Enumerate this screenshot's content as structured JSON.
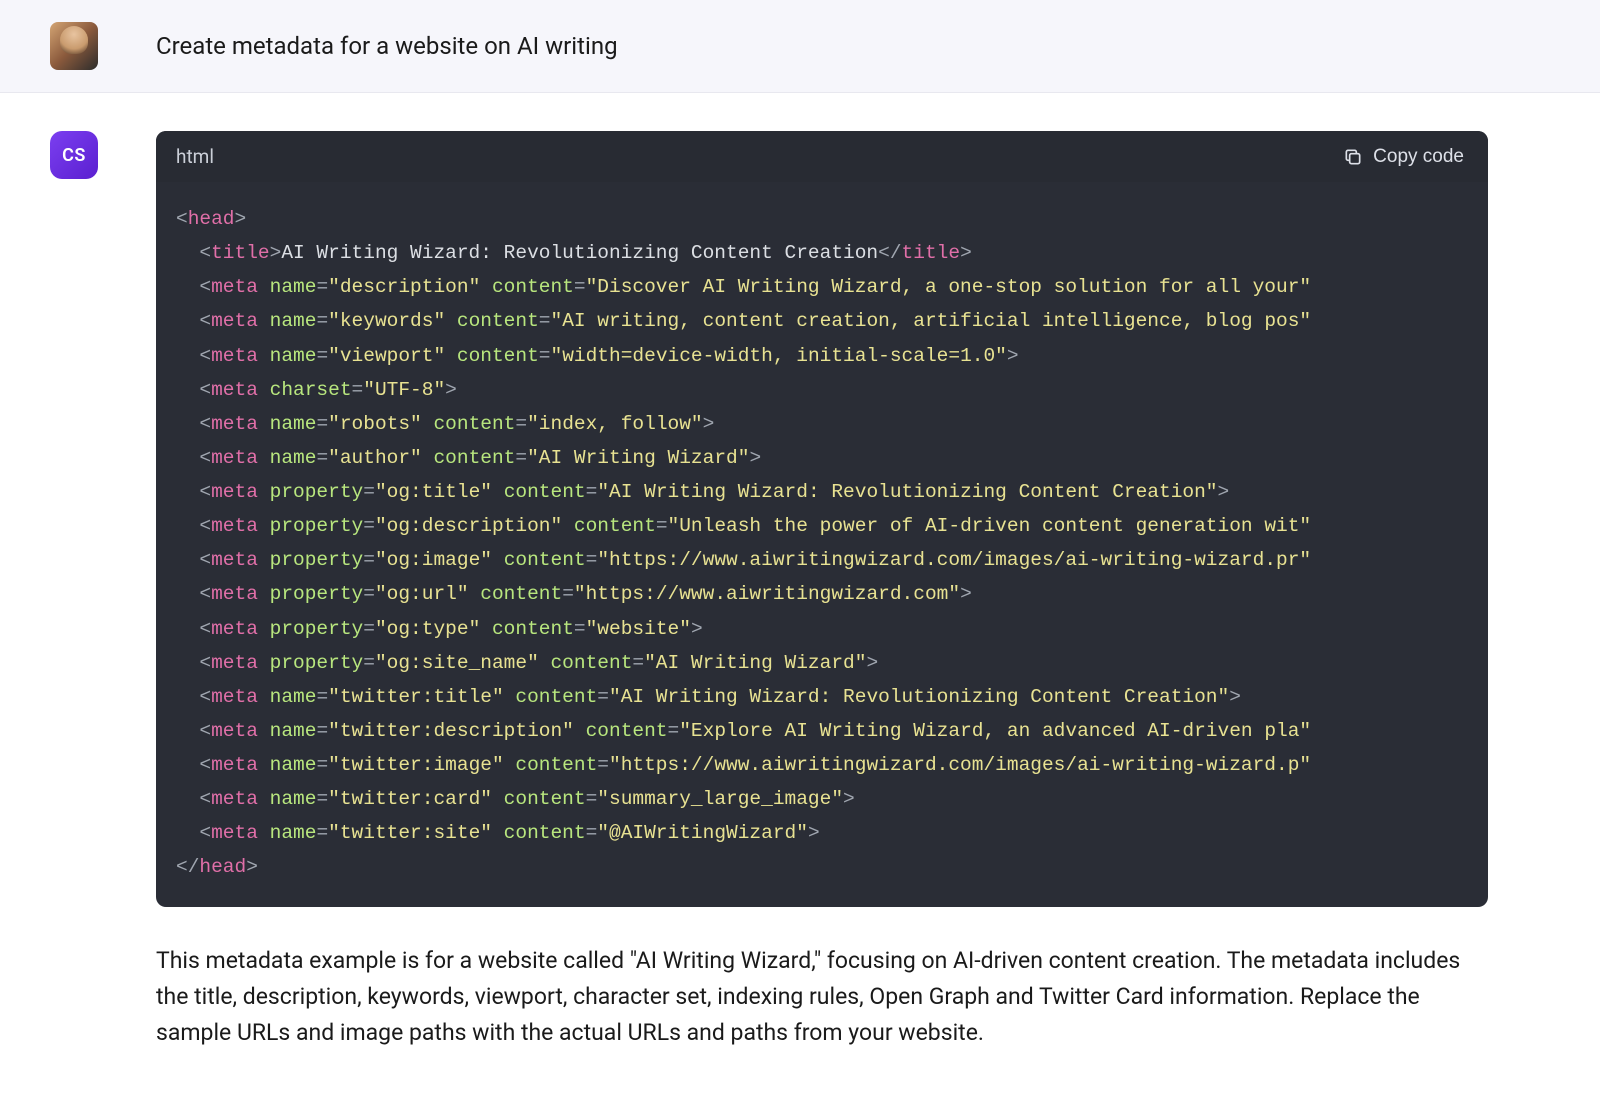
{
  "user": {
    "prompt": "Create metadata for a website on AI writing"
  },
  "assistant": {
    "avatar_label": "CS",
    "code": {
      "language": "html",
      "copy_label": "Copy code",
      "lines": [
        {
          "indent": 0,
          "open": "<",
          "tag": "head",
          "close": ">"
        },
        {
          "indent": 1,
          "open": "<",
          "tag": "title",
          "close": ">",
          "text": "AI Writing Wizard: Revolutionizing Content Creation",
          "open2": "</",
          "tag2": "title",
          "close2": ">"
        },
        {
          "indent": 1,
          "open": "<",
          "tag": "meta",
          "attr1": "name",
          "val1": "description",
          "attr2": "content",
          "val2": "Discover AI Writing Wizard, a one-stop solution for all your"
        },
        {
          "indent": 1,
          "open": "<",
          "tag": "meta",
          "attr1": "name",
          "val1": "keywords",
          "attr2": "content",
          "val2": "AI writing, content creation, artificial intelligence, blog pos"
        },
        {
          "indent": 1,
          "open": "<",
          "tag": "meta",
          "attr1": "name",
          "val1": "viewport",
          "attr2": "content",
          "val2": "width=device-width, initial-scale=1.0",
          "endclose": ">"
        },
        {
          "indent": 1,
          "open": "<",
          "tag": "meta",
          "attr1": "charset",
          "val1": "UTF-8",
          "endclose": ">"
        },
        {
          "indent": 1,
          "open": "<",
          "tag": "meta",
          "attr1": "name",
          "val1": "robots",
          "attr2": "content",
          "val2": "index, follow",
          "endclose": ">"
        },
        {
          "indent": 1,
          "open": "<",
          "tag": "meta",
          "attr1": "name",
          "val1": "author",
          "attr2": "content",
          "val2": "AI Writing Wizard",
          "endclose": ">"
        },
        {
          "indent": 1,
          "open": "<",
          "tag": "meta",
          "attr1": "property",
          "val1": "og:title",
          "attr2": "content",
          "val2": "AI Writing Wizard: Revolutionizing Content Creation",
          "endclose": ">"
        },
        {
          "indent": 1,
          "open": "<",
          "tag": "meta",
          "attr1": "property",
          "val1": "og:description",
          "attr2": "content",
          "val2": "Unleash the power of AI-driven content generation wit"
        },
        {
          "indent": 1,
          "open": "<",
          "tag": "meta",
          "attr1": "property",
          "val1": "og:image",
          "attr2": "content",
          "val2": "https://www.aiwritingwizard.com/images/ai-writing-wizard.pr"
        },
        {
          "indent": 1,
          "open": "<",
          "tag": "meta",
          "attr1": "property",
          "val1": "og:url",
          "attr2": "content",
          "val2": "https://www.aiwritingwizard.com",
          "endclose": ">"
        },
        {
          "indent": 1,
          "open": "<",
          "tag": "meta",
          "attr1": "property",
          "val1": "og:type",
          "attr2": "content",
          "val2": "website",
          "endclose": ">"
        },
        {
          "indent": 1,
          "open": "<",
          "tag": "meta",
          "attr1": "property",
          "val1": "og:site_name",
          "attr2": "content",
          "val2": "AI Writing Wizard",
          "endclose": ">"
        },
        {
          "indent": 1,
          "open": "<",
          "tag": "meta",
          "attr1": "name",
          "val1": "twitter:title",
          "attr2": "content",
          "val2": "AI Writing Wizard: Revolutionizing Content Creation",
          "endclose": ">"
        },
        {
          "indent": 1,
          "open": "<",
          "tag": "meta",
          "attr1": "name",
          "val1": "twitter:description",
          "attr2": "content",
          "val2": "Explore AI Writing Wizard, an advanced AI-driven pla"
        },
        {
          "indent": 1,
          "open": "<",
          "tag": "meta",
          "attr1": "name",
          "val1": "twitter:image",
          "attr2": "content",
          "val2": "https://www.aiwritingwizard.com/images/ai-writing-wizard.p"
        },
        {
          "indent": 1,
          "open": "<",
          "tag": "meta",
          "attr1": "name",
          "val1": "twitter:card",
          "attr2": "content",
          "val2": "summary_large_image",
          "endclose": ">"
        },
        {
          "indent": 1,
          "open": "<",
          "tag": "meta",
          "attr1": "name",
          "val1": "twitter:site",
          "attr2": "content",
          "val2": "@AIWritingWizard",
          "endclose": ">"
        },
        {
          "indent": 0,
          "open": "</",
          "tag": "head",
          "close": ">"
        }
      ]
    },
    "explanation": "This metadata example is for a website called \"AI Writing Wizard,\" focusing on AI-driven content creation. The metadata includes the title, description, keywords, viewport, character set, indexing rules, Open Graph and Twitter Card information. Replace the sample URLs and image paths with the actual URLs and paths from your website."
  }
}
